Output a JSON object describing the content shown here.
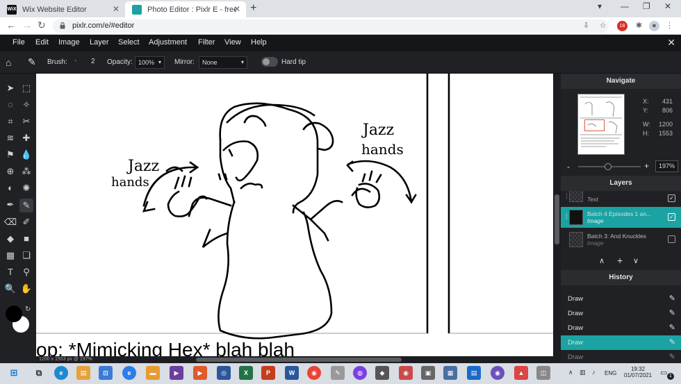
{
  "browser": {
    "tabs": [
      {
        "title": "Wix Website Editor",
        "favicon_text": "WiX"
      },
      {
        "title": "Photo Editor : Pixlr E - free image"
      }
    ],
    "new_tab": "+",
    "url": "pixlr.com/e/#editor",
    "profile_badge": "18"
  },
  "menu": [
    "File",
    "Edit",
    "Image",
    "Layer",
    "Select",
    "Adjustment",
    "Filter",
    "View",
    "Help"
  ],
  "options": {
    "brush_label": "Brush:",
    "brush_size": "2",
    "opacity_label": "Opacity:",
    "opacity_value": "100%",
    "mirror_label": "Mirror:",
    "mirror_value": "None",
    "hardtip_label": "Hard tip"
  },
  "canvas": {
    "drawing_text_1": "Jazz",
    "drawing_text_2": "hands",
    "drawing_text_3": "Jazz",
    "drawing_text_4": "hands",
    "caption": "op: *Mimicking Hex* blah blah",
    "status": "1200 x 1553 px @ 197%"
  },
  "navigate": {
    "title": "Navigate",
    "x_label": "X:",
    "x_value": "431",
    "y_label": "Y:",
    "y_value": "806",
    "w_label": "W:",
    "w_value": "1200",
    "h_label": "H:",
    "h_value": "1553",
    "zoom": "197%"
  },
  "layers": {
    "title": "Layers",
    "items": [
      {
        "name": "",
        "type": "Text",
        "checked": true
      },
      {
        "name": "Batch 4 Episodes 1 an...",
        "type": "Image",
        "checked": true,
        "selected": true
      },
      {
        "name": "Batch 3: And Knuckles",
        "type": "Image",
        "checked": false
      }
    ]
  },
  "history": {
    "title": "History",
    "items": [
      {
        "label": "Draw"
      },
      {
        "label": "Draw"
      },
      {
        "label": "Draw"
      },
      {
        "label": "Draw",
        "selected": true
      },
      {
        "label": "Draw"
      }
    ]
  },
  "taskbar": {
    "lang": "ENG",
    "time": "19:32",
    "date": "01/07/2021",
    "notifications": "1"
  },
  "colors": {
    "accent": "#1ba3a3",
    "app_bg": "#202124",
    "menubar": "#151619"
  }
}
